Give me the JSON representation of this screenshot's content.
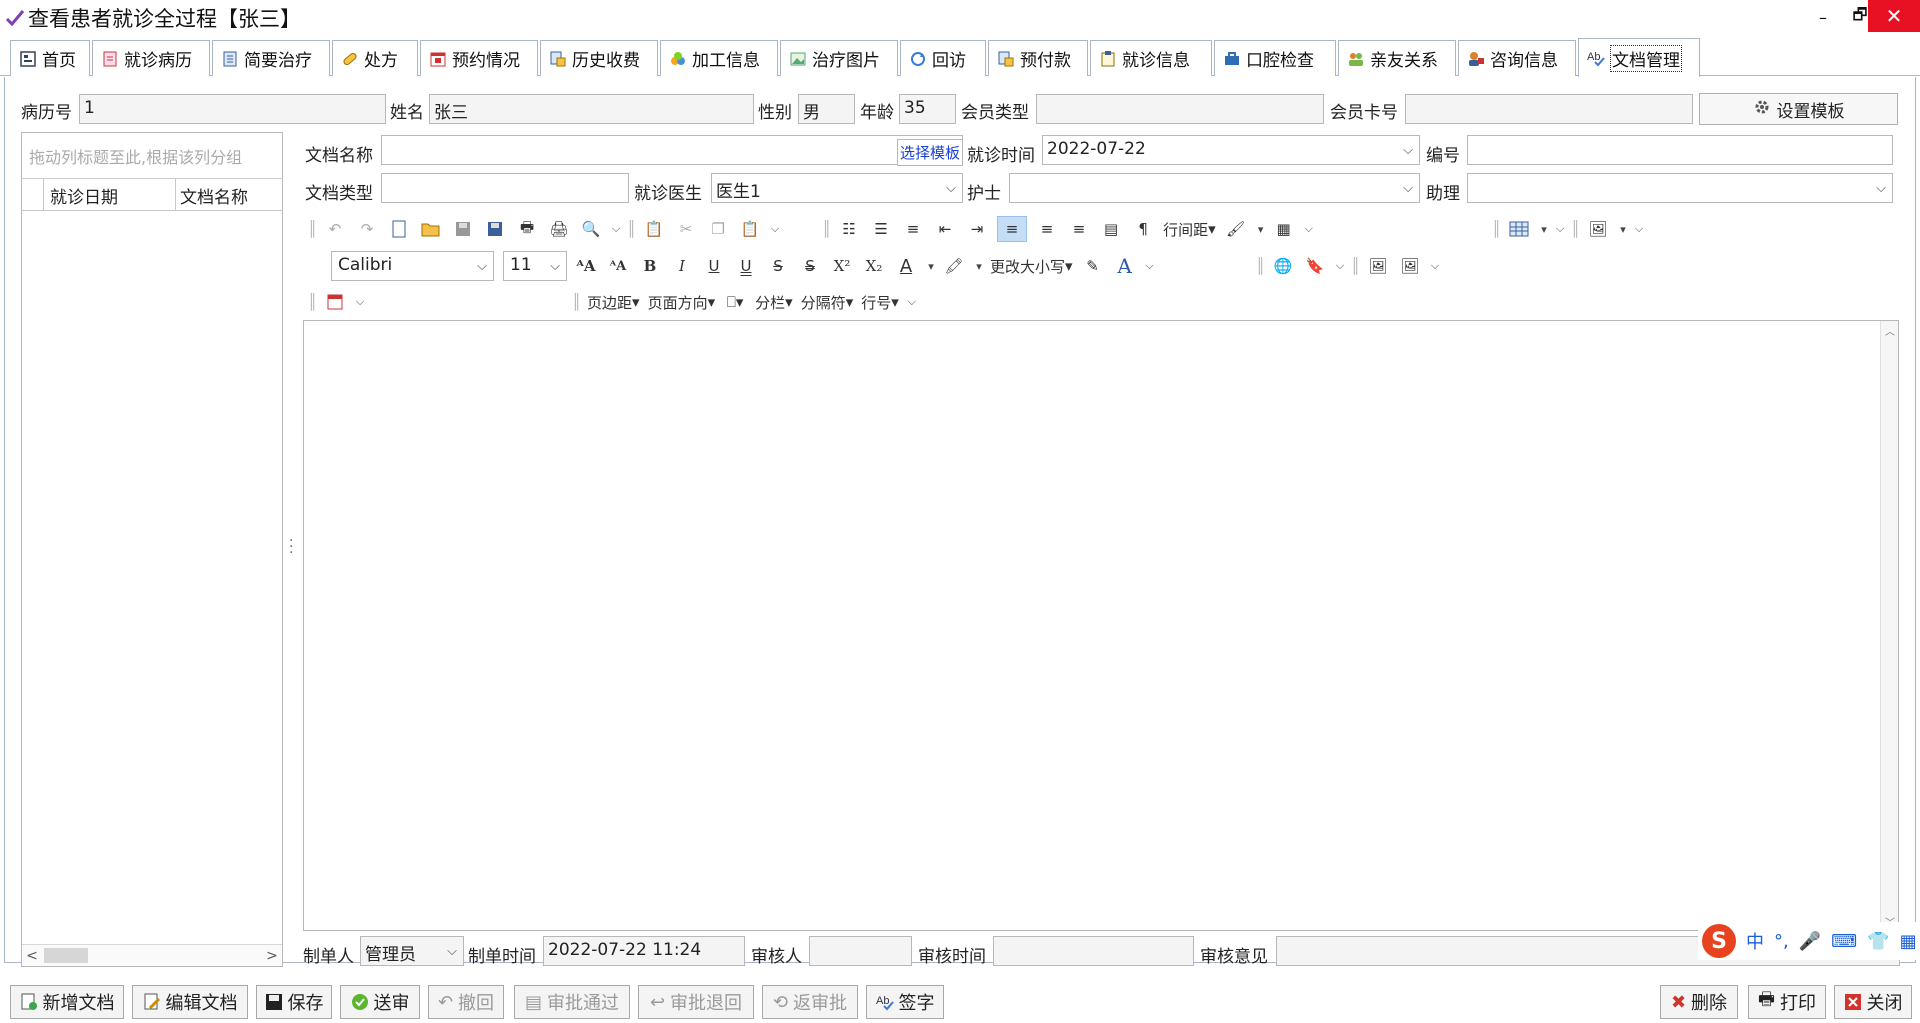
{
  "window": {
    "title": "查看患者就诊全过程【张三】",
    "controls": {
      "minimize": "–",
      "restore": "🗗",
      "close": "✕"
    }
  },
  "tabs": [
    {
      "label": "首页",
      "icon": "home-icon"
    },
    {
      "label": "就诊病历",
      "icon": "medical-record-icon"
    },
    {
      "label": "简要治疗",
      "icon": "document-icon"
    },
    {
      "label": "处方",
      "icon": "pill-icon"
    },
    {
      "label": "预约情况",
      "icon": "calendar-icon"
    },
    {
      "label": "历史收费",
      "icon": "history-fee-icon"
    },
    {
      "label": "加工信息",
      "icon": "process-icon"
    },
    {
      "label": "治疗图片",
      "icon": "image-icon"
    },
    {
      "label": "回访",
      "icon": "refresh-icon"
    },
    {
      "label": "预付款",
      "icon": "prepay-icon"
    },
    {
      "label": "就诊信息",
      "icon": "clipboard-icon"
    },
    {
      "label": "口腔检查",
      "icon": "briefcase-icon"
    },
    {
      "label": "亲友关系",
      "icon": "people-icon"
    },
    {
      "label": "咨询信息",
      "icon": "consult-icon"
    },
    {
      "label": "文档管理",
      "icon": "spellcheck-icon",
      "active": true
    }
  ],
  "patient": {
    "record_no_label": "病历号",
    "record_no": "1",
    "name_label": "姓名",
    "name": "张三",
    "gender_label": "性别",
    "gender": "男",
    "age_label": "年龄",
    "age": "35",
    "member_type_label": "会员类型",
    "member_type": "",
    "member_card_label": "会员卡号",
    "member_card": "",
    "template_btn": "设置模板"
  },
  "left_grid": {
    "group_hint": "拖动列标题至此,根据该列分组",
    "columns": [
      "就诊日期",
      "文档名称"
    ]
  },
  "doc": {
    "name_label": "文档名称",
    "name": "",
    "select_template": "选择模板",
    "visit_time_label": "就诊时间",
    "visit_time": "2022-07-22",
    "number_label": "编号",
    "number": "",
    "type_label": "文档类型",
    "type": "",
    "doctor_label": "就诊医生",
    "doctor": "医生1",
    "nurse_label": "护士",
    "nurse": "",
    "assistant_label": "助理",
    "assistant": ""
  },
  "toolbar": {
    "font_name": "Calibri",
    "font_size": "11",
    "line_spacing": "行间距",
    "change_case": "更改大小写",
    "margins": "页边距",
    "orientation": "页面方向",
    "columns": "分栏",
    "breaks": "分隔符",
    "line_numbers": "行号"
  },
  "footer": {
    "creator_label": "制单人",
    "creator": "管理员",
    "create_time_label": "制单时间",
    "create_time": "2022-07-22 11:24",
    "reviewer_label": "审核人",
    "reviewer": "",
    "review_time_label": "审核时间",
    "review_time": "",
    "review_opinion_label": "审核意见",
    "review_opinion": ""
  },
  "ime": {
    "logo": "S",
    "lang": "中"
  },
  "actions": {
    "new_doc": "新增文档",
    "edit_doc": "编辑文档",
    "save": "保存",
    "submit": "送审",
    "revoke": "撤回",
    "approve": "审批通过",
    "reject": "审批退回",
    "unapprove": "返审批",
    "sign": "签字",
    "delete": "删除",
    "print": "打印",
    "close": "关闭"
  }
}
